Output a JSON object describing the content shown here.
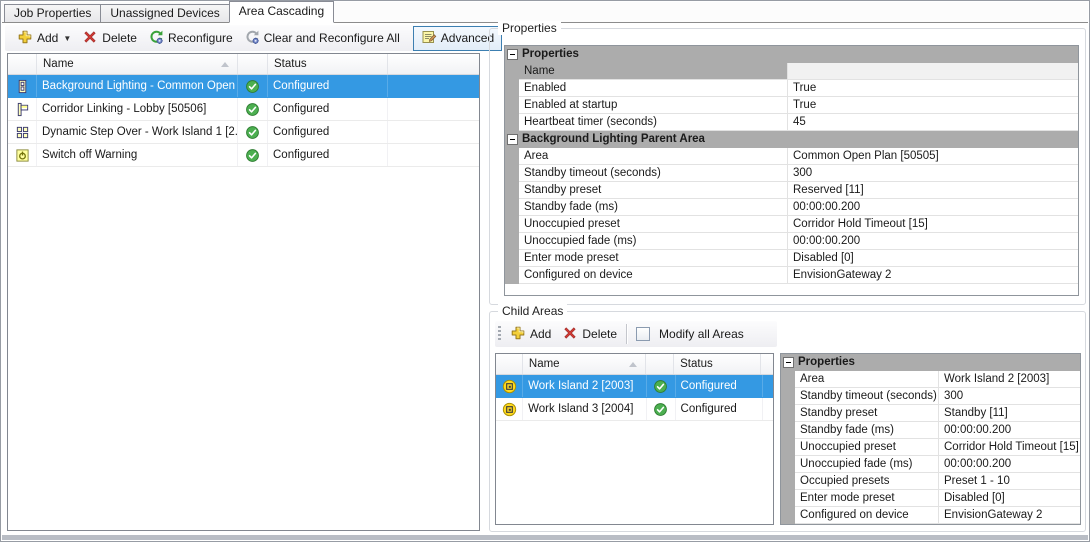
{
  "tabs": [
    {
      "label": "Job Properties",
      "active": false
    },
    {
      "label": "Unassigned Devices",
      "active": false
    },
    {
      "label": "Area Cascading",
      "active": true
    }
  ],
  "main_toolbar": {
    "add": "Add",
    "delete": "Delete",
    "reconfigure": "Reconfigure",
    "clear_and_reconfigure_all": "Clear and Reconfigure All",
    "advanced": "Advanced"
  },
  "main_list": {
    "columns": {
      "name": "Name",
      "status": "Status"
    },
    "rows": [
      {
        "icon": "background-lighting-icon",
        "name": "Background Lighting - Common Open ...",
        "status": "Configured",
        "selected": true
      },
      {
        "icon": "corridor-linking-icon",
        "name": "Corridor Linking - Lobby [50506]",
        "status": "Configured",
        "selected": false
      },
      {
        "icon": "dynamic-step-over-icon",
        "name": "Dynamic Step Over - Work Island 1 [2...",
        "status": "Configured",
        "selected": false
      },
      {
        "icon": "switch-off-warning-icon",
        "name": "Switch off Warning",
        "status": "Configured",
        "selected": false
      }
    ]
  },
  "properties_panel": {
    "title": "Properties",
    "rows": [
      {
        "type": "category",
        "label": "Properties"
      },
      {
        "type": "item",
        "label": "Name",
        "value": "",
        "selected": true
      },
      {
        "type": "item",
        "label": "Enabled",
        "value": "True"
      },
      {
        "type": "item",
        "label": "Enabled at startup",
        "value": "True"
      },
      {
        "type": "item",
        "label": "Heartbeat timer (seconds)",
        "value": "45"
      },
      {
        "type": "category",
        "label": "Background Lighting Parent Area"
      },
      {
        "type": "item",
        "label": "Area",
        "value": "Common Open Plan [50505]"
      },
      {
        "type": "item",
        "label": "Standby timeout (seconds)",
        "value": "300"
      },
      {
        "type": "item",
        "label": "Standby preset",
        "value": "Reserved [11]"
      },
      {
        "type": "item",
        "label": "Standby fade (ms)",
        "value": "00:00:00.200"
      },
      {
        "type": "item",
        "label": "Unoccupied preset",
        "value": "Corridor Hold Timeout [15]"
      },
      {
        "type": "item",
        "label": "Unoccupied fade (ms)",
        "value": "00:00:00.200"
      },
      {
        "type": "item",
        "label": "Enter mode preset",
        "value": "Disabled [0]"
      },
      {
        "type": "item",
        "label": "Configured on device",
        "value": "EnvisionGateway 2"
      }
    ]
  },
  "child_areas": {
    "title": "Child Areas",
    "toolbar": {
      "add": "Add",
      "delete": "Delete",
      "modify_all": "Modify all Areas",
      "modify_all_checked": false
    },
    "list": {
      "columns": {
        "name": "Name",
        "status": "Status"
      },
      "rows": [
        {
          "icon": "area-icon",
          "name": "Work Island 2 [2003]",
          "status": "Configured",
          "selected": true
        },
        {
          "icon": "area-icon",
          "name": "Work Island 3 [2004]",
          "status": "Configured",
          "selected": false
        }
      ]
    },
    "properties": {
      "rows": [
        {
          "type": "category",
          "label": "Properties"
        },
        {
          "type": "item",
          "label": "Area",
          "value": "Work Island 2 [2003]"
        },
        {
          "type": "item",
          "label": "Standby timeout (seconds)",
          "value": "300"
        },
        {
          "type": "item",
          "label": "Standby preset",
          "value": "Standby [11]"
        },
        {
          "type": "item",
          "label": "Standby fade (ms)",
          "value": "00:00:00.200"
        },
        {
          "type": "item",
          "label": "Unoccupied preset",
          "value": "Corridor Hold Timeout [15]"
        },
        {
          "type": "item",
          "label": "Unoccupied fade (ms)",
          "value": "00:00:00.200"
        },
        {
          "type": "item",
          "label": "Occupied presets",
          "value": "Preset 1 - 10"
        },
        {
          "type": "item",
          "label": "Enter mode preset",
          "value": "Disabled [0]"
        },
        {
          "type": "item",
          "label": "Configured on device",
          "value": "EnvisionGateway 2"
        }
      ]
    }
  },
  "colors": {
    "selection_blue": "#3499e3",
    "category_header_gray": "#acacac",
    "status_ok_green": "#4caf50",
    "icon_yellow": "#ffffbe",
    "advanced_toggle_border": "#3c7fb1"
  }
}
